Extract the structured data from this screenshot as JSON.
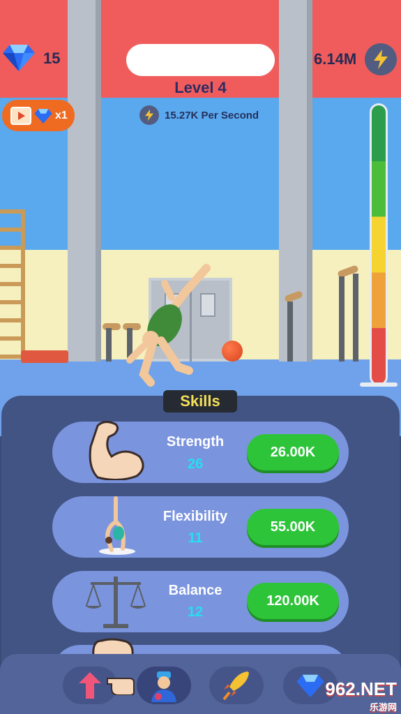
{
  "hud": {
    "gems": "15",
    "energy": "6.14M",
    "level": "Level 4",
    "per_second": "15.27K Per Second",
    "video_reward": "x1"
  },
  "skills": {
    "title": "Skills",
    "items": [
      {
        "name": "Strength",
        "level": "26",
        "price": "26.00K",
        "icon": "flexed-bicep-icon"
      },
      {
        "name": "Flexibility",
        "level": "11",
        "price": "55.00K",
        "icon": "gymnast-bridge-icon"
      },
      {
        "name": "Balance",
        "level": "12",
        "price": "120.00K",
        "icon": "scale-balance-icon"
      }
    ]
  },
  "nav": {
    "items": [
      "upgrade-arrow-icon",
      "coach-icon",
      "rocket-icon",
      "gem-shop-icon"
    ]
  },
  "watermark": {
    "brand": "962.NET",
    "sub": "乐游网"
  },
  "colors": {
    "top_wall": "#f05c5c",
    "panel": "#425484",
    "card": "#7b94de",
    "buy_button": "#2ec43a",
    "level_text": "#24e0f0"
  }
}
